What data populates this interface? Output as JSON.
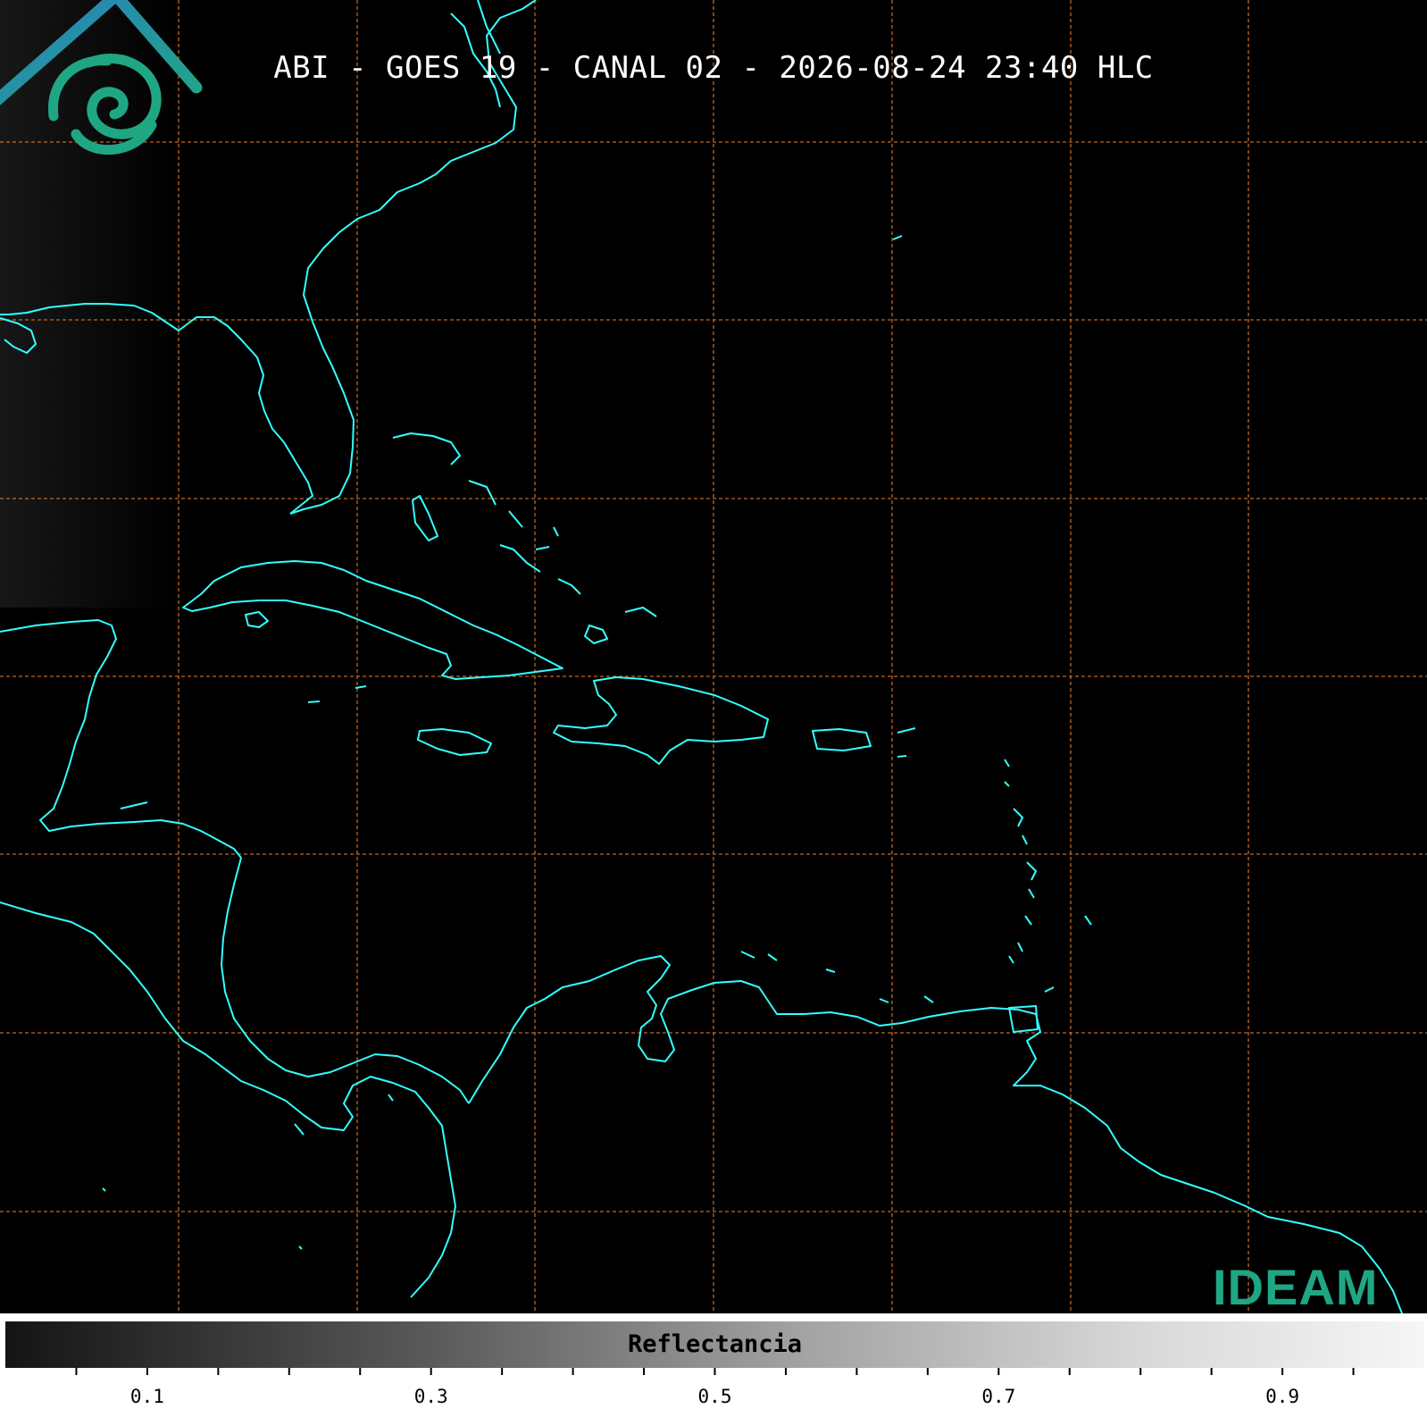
{
  "title": "ABI - GOES 19 - CANAL 02 - 2026-08-24 23:40 HLC",
  "colorbar": {
    "label": "Reflectancia",
    "tick_labels": [
      "0.1",
      "0.3",
      "0.5",
      "0.7",
      "0.9"
    ],
    "min": 0.0,
    "max": 1.0
  },
  "logo": {
    "text": "IDEAM"
  },
  "colors": {
    "coastline": "#33ffff",
    "gridline": "#e07a2c",
    "background": "#000000",
    "logo_green": "#1fa784",
    "logo_blue": "#2a7fc1"
  }
}
